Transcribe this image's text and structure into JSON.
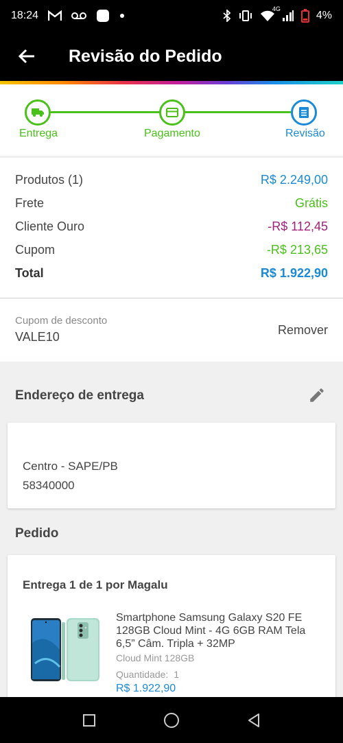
{
  "status": {
    "time": "18:24",
    "battery": "4%",
    "network_label": "4G",
    "icons_left": [
      "gmail-icon",
      "voicemail-icon",
      "app-icon",
      "dot-icon"
    ],
    "icons_right": [
      "bluetooth-icon",
      "vibrate-icon",
      "wifi-icon",
      "signal-icon",
      "battery-low-icon"
    ]
  },
  "appbar": {
    "title": "Revisão do Pedido"
  },
  "stepper": {
    "steps": [
      {
        "label": "Entrega",
        "state": "done",
        "icon": "truck-icon"
      },
      {
        "label": "Pagamento",
        "state": "done",
        "icon": "credit-card-icon"
      },
      {
        "label": "Revisão",
        "state": "current",
        "icon": "list-icon"
      }
    ]
  },
  "summary": {
    "rows": [
      {
        "label": "Produtos (1)",
        "value": "R$ 2.249,00"
      },
      {
        "label": "Frete",
        "value": "Grátis"
      },
      {
        "label": "Cliente Ouro",
        "value": "-R$ 112,45"
      },
      {
        "label": "Cupom",
        "value": "-R$ 213,65"
      }
    ],
    "total_label": "Total",
    "total_value": "R$ 1.922,90"
  },
  "coupon": {
    "label": "Cupom de desconto",
    "code": "VALE10",
    "remove_label": "Remover"
  },
  "address": {
    "title": "Endereço de entrega",
    "line1": "Centro - SAPE/PB",
    "line2": "58340000"
  },
  "order": {
    "title": "Pedido",
    "delivery_label": "Entrega 1 de 1 por Magalu",
    "product": {
      "name": "Smartphone Samsung Galaxy S20 FE 128GB Cloud Mint - 4G 6GB RAM Tela 6,5” Câm. Tripla + 32MP",
      "variant": "Cloud Mint 128GB",
      "quantity_label": "Quantidade:",
      "quantity": "1",
      "price": "R$ 1.922,90"
    }
  },
  "colors": {
    "green": "#4ac01a",
    "blue": "#1a8ad8",
    "purple": "#a0207a"
  }
}
